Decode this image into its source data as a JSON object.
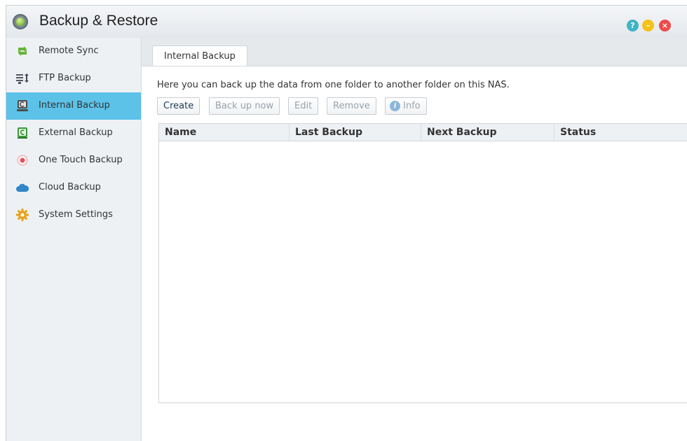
{
  "window": {
    "title": "Backup & Restore",
    "controls": {
      "help": "?",
      "minimize": "–",
      "close": "×"
    }
  },
  "sidebar": {
    "items": [
      {
        "label": "Remote Sync",
        "icon": "sync-icon",
        "active": false
      },
      {
        "label": "FTP Backup",
        "icon": "ftp-icon",
        "active": false
      },
      {
        "label": "Internal Backup",
        "icon": "internal-backup-icon",
        "active": true
      },
      {
        "label": "External Backup",
        "icon": "external-backup-icon",
        "active": false
      },
      {
        "label": "One Touch Backup",
        "icon": "one-touch-icon",
        "active": false
      },
      {
        "label": "Cloud Backup",
        "icon": "cloud-icon",
        "active": false
      },
      {
        "label": "System Settings",
        "icon": "gear-icon",
        "active": false
      }
    ]
  },
  "main": {
    "tab": "Internal Backup",
    "description": "Here you can back up the data from one folder to another folder on this NAS.",
    "toolbar": {
      "create": "Create",
      "backup_now": "Back up now",
      "edit": "Edit",
      "remove": "Remove",
      "info": "Info"
    },
    "table": {
      "columns": [
        "Name",
        "Last Backup",
        "Next Backup",
        "Status"
      ],
      "rows": []
    }
  },
  "colors": {
    "accent": "#5cc2e8",
    "sidebar_bg": "#eef1f4",
    "help": "#3fb4c6",
    "minimize": "#f5c21a",
    "close": "#ee4b4b"
  }
}
